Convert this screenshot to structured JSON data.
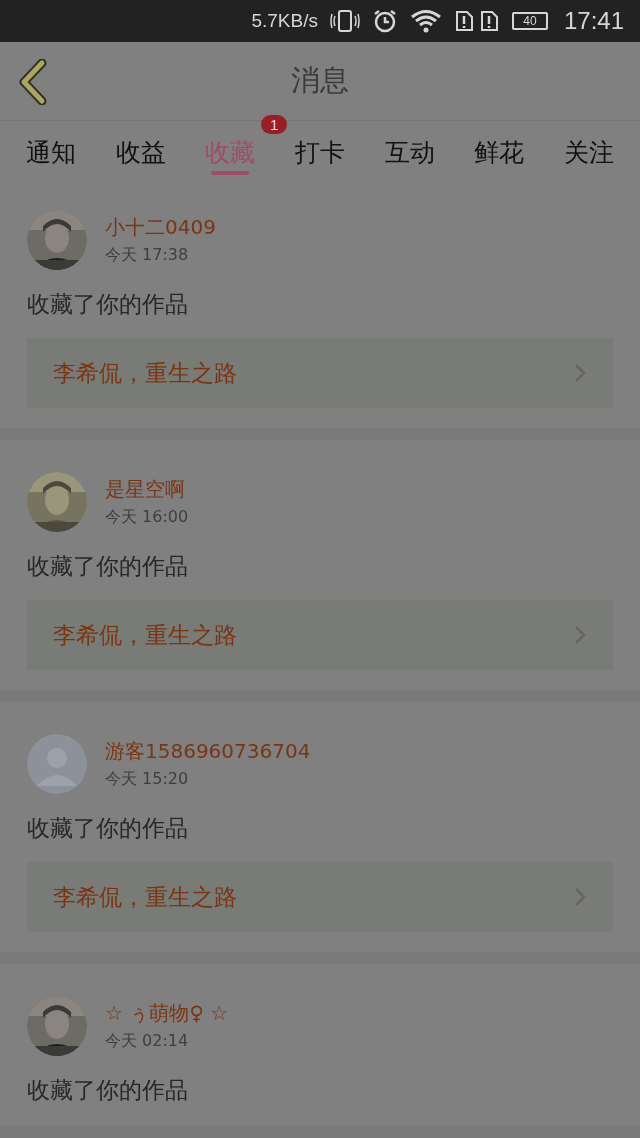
{
  "status_bar": {
    "speed": "5.7KB/s",
    "battery": "40",
    "time": "17:41"
  },
  "header": {
    "title": "消息"
  },
  "tabs": [
    {
      "label": "通知",
      "selected": false
    },
    {
      "label": "收益",
      "selected": false
    },
    {
      "label": "收藏",
      "selected": true,
      "badge": "1"
    },
    {
      "label": "打卡",
      "selected": false
    },
    {
      "label": "互动",
      "selected": false
    },
    {
      "label": "鲜花",
      "selected": false
    },
    {
      "label": "关注",
      "selected": false
    }
  ],
  "messages": [
    {
      "name": "小十二0409",
      "time": "今天 17:38",
      "text": "收藏了你的作品",
      "work": "李希侃，重生之路"
    },
    {
      "name": "是星空啊",
      "time": "今天 16:00",
      "text": "收藏了你的作品",
      "work": "李希侃，重生之路"
    },
    {
      "avatar": {
        "kind": "default"
      },
      "name": "游客1586960736704",
      "time": "今天 15:20",
      "text": "收藏了你的作品",
      "work": "李希侃，重生之路"
    },
    {
      "name": "☆ ぅ萌物♀ ☆",
      "time": "今天 02:14",
      "text": "收藏了你的作品"
    }
  ]
}
